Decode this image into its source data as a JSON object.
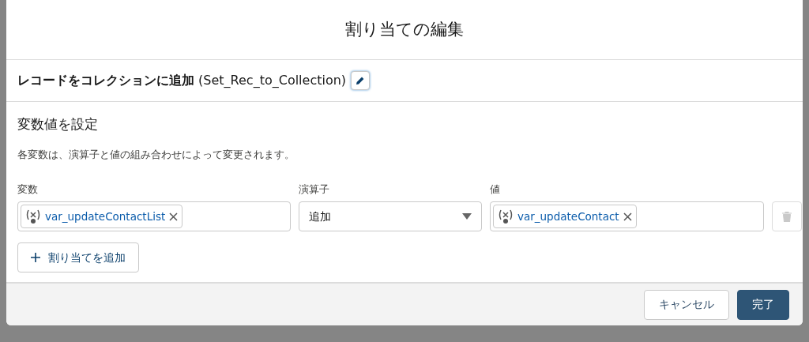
{
  "modal": {
    "title": "割り当ての編集"
  },
  "element": {
    "label_bold": "レコードをコレクションに追加",
    "api_name": "(Set_Rec_to_Collection)"
  },
  "section": {
    "title": "変数値を設定",
    "description": "各変数は、演算子と値の組み合わせによって変更されます。"
  },
  "columns": [
    "変数",
    "演算子",
    "値"
  ],
  "assignments": [
    {
      "variable": "var_updateContactList",
      "operator": "追加",
      "value": "var_updateContact",
      "delete_disabled": true
    }
  ],
  "add_button": "割り当てを追加",
  "footer": {
    "buttons": [
      {
        "label": "キャンセル",
        "kind": "neutral"
      },
      {
        "label": "完了",
        "kind": "brand"
      }
    ]
  }
}
